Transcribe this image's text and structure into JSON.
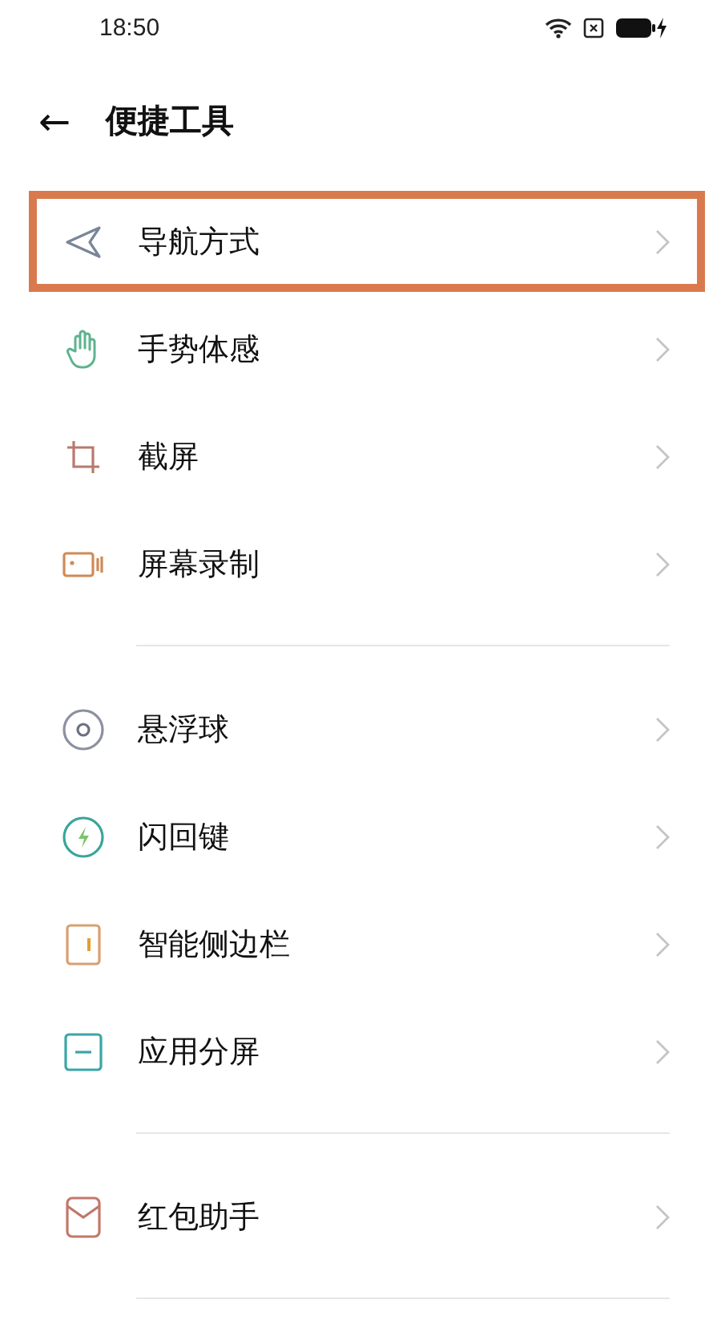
{
  "status_bar": {
    "time": "18:50"
  },
  "header": {
    "back": "←",
    "title": "便捷工具"
  },
  "groups": [
    {
      "items": [
        {
          "label": "导航方式",
          "kind": "navigate",
          "highlighted": true
        },
        {
          "label": "手势体感",
          "kind": "hand",
          "highlighted": false
        },
        {
          "label": "截屏",
          "kind": "crop",
          "highlighted": false
        },
        {
          "label": "屏幕录制",
          "kind": "record",
          "highlighted": false
        }
      ]
    },
    {
      "items": [
        {
          "label": "悬浮球",
          "kind": "ball",
          "highlighted": false
        },
        {
          "label": "闪回键",
          "kind": "flash",
          "highlighted": false
        },
        {
          "label": "智能侧边栏",
          "kind": "sidebar",
          "highlighted": false
        },
        {
          "label": "应用分屏",
          "kind": "split",
          "highlighted": false
        }
      ]
    },
    {
      "items": [
        {
          "label": "红包助手",
          "kind": "envelope",
          "highlighted": false
        }
      ]
    }
  ]
}
